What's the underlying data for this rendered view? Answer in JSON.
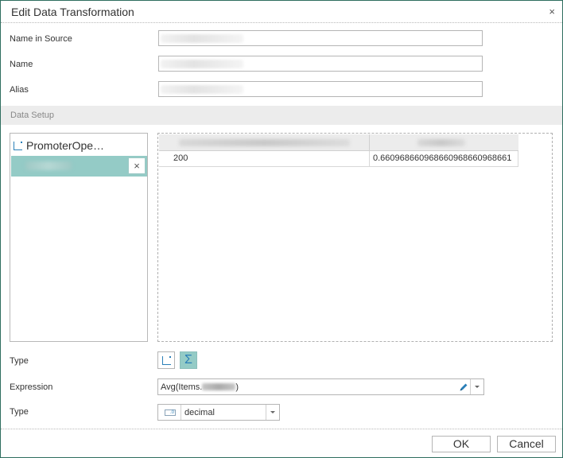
{
  "dialog": {
    "title": "Edit Data Transformation",
    "close_glyph": "×"
  },
  "form": {
    "name_in_source_label": "Name in Source",
    "name_label": "Name",
    "alias_label": "Alias"
  },
  "data_setup": {
    "section_label": "Data Setup",
    "tree_items": [
      {
        "label": "PromoterOpe…",
        "icon": "dimension-axis-icon"
      }
    ],
    "remove_glyph": "×",
    "grid": {
      "row": [
        "200",
        "0.660968660968660968660968661"
      ]
    }
  },
  "type_row": {
    "label": "Type",
    "options": [
      "dimension-axis-icon",
      "sigma-measure-icon"
    ],
    "sigma_glyph": "Σ",
    "active": "sigma-measure-icon"
  },
  "expression": {
    "label": "Expression",
    "prefix": "Avg(Items.",
    "suffix": ")"
  },
  "data_type": {
    "label": "Type",
    "value": "decimal",
    "icon_glyph": ".0"
  },
  "footer": {
    "ok_label": "OK",
    "cancel_label": "Cancel"
  },
  "colors": {
    "accent": "#94cbc6",
    "icon_blue": "#2a7fb8",
    "border": "#2e6e5f"
  }
}
